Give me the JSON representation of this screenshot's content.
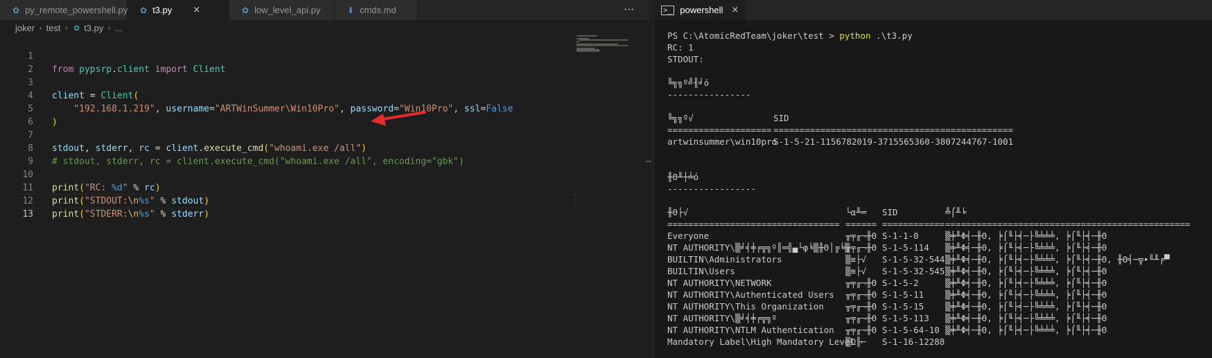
{
  "editor": {
    "tabs": [
      {
        "label": "py_remote_powershell.py",
        "icon": "python-file-icon",
        "active": false
      },
      {
        "label": "t3.py",
        "icon": "python-file-icon",
        "active": true
      },
      {
        "label": "low_level_api.py",
        "icon": "python-file-icon",
        "active": false
      },
      {
        "label": "cmds.md",
        "icon": "markdown-file-icon",
        "active": false
      }
    ],
    "more": "···",
    "close": "×",
    "breadcrumb": [
      "joker",
      "test",
      "t3.py",
      "..."
    ],
    "line_numbers": [
      "1",
      "2",
      "3",
      "4",
      "5",
      "6",
      "7",
      "8",
      "9",
      "10",
      "11",
      "12",
      "13"
    ],
    "code": {
      "l1": {
        "from": "from",
        "module": "pypsrp",
        "dot": ".",
        "mod2": "client",
        "import": "import",
        "cls": "Client"
      },
      "l3": {
        "var": "client",
        "eq": " = ",
        "cls": "Client",
        "paren": "("
      },
      "l4": {
        "ip": "\"192.168.1.219\"",
        "c1": ", ",
        "k1": "username",
        "e1": "=",
        "user": "\"ARTWinSummer\\Win10Pro\"",
        "c2": ", ",
        "k2": "password",
        "e2": "=",
        "pw": "\"Win10Pro\"",
        "c3": ", ",
        "k3": "ssl",
        "e3": "=",
        "ssl": "False"
      },
      "l5": ")",
      "l7": {
        "v1": "stdout",
        "c1": ", ",
        "v2": "stderr",
        "c2": ", ",
        "v3": "rc",
        "eq": " = ",
        "obj": "client",
        "dot": ".",
        "fn": "execute_cmd",
        "p1": "(",
        "arg": "\"whoami.exe /all\"",
        "p2": ")"
      },
      "l8": "# stdout, stderr, rc = client.execute_cmd(\"whoami.exe /all\", encoding=\"gbk\")",
      "l10": {
        "fn": "print",
        "p1": "(",
        "s1": "\"RC: ",
        "esc": "%d",
        "s2": "\"",
        "op": " % ",
        "v": "rc",
        "p2": ")"
      },
      "l11": {
        "fn": "print",
        "p1": "(",
        "s1": "\"STDOUT:",
        "esc1": "\\n",
        "esc2": "%s",
        "s2": "\"",
        "op": " % ",
        "v": "stdout",
        "p2": ")"
      },
      "l12": {
        "fn": "print",
        "p1": "(",
        "s1": "\"STDERR:",
        "esc1": "\\n",
        "esc2": "%s",
        "s2": "\"",
        "op": " % ",
        "v": "stderr",
        "p2": ")"
      }
    }
  },
  "terminal": {
    "tab_label": "powershell",
    "tab_icon": "terminal-icon",
    "prompt": "PS C:\\AtomicRedTeam\\joker\\test > ",
    "cmd": "python",
    "cmd_args": " .\\t3.py",
    "rc_line": "RC: 1",
    "stdout_line": "STDOUT:",
    "user_info_header": "╚╗╗º╝╢╛ó",
    "user_info_rule": "----------------",
    "user_table_h1": "╚╗╗º√",
    "user_table_h2": "SID",
    "user_table_rule1": "====================",
    "user_table_rule2": "==============================================",
    "user_row_name": "artwinsummer\\win10pro",
    "user_row_sid": "S-1-5-21-1156782019-3715565360-3807244767-1001",
    "groups_header": "╫Θ╨┼╧ó",
    "groups_rule": "-----------------",
    "groups_h1": "╫Θ├√",
    "groups_h2": "└α╨═",
    "groups_h3": "SID",
    "groups_h4": "╩⌠╨╘",
    "groups_r1": "=================================",
    "groups_r2": "======",
    "groups_r3": "============",
    "groups_r4": "===============================================",
    "groups": [
      {
        "name": "Everyone",
        "type": "╥╤╓¬╫Θ",
        "sid": "S-1-1-0",
        "attr": "▒╪╨Φ╡─╫Θ, ╞⌠╙├╡─├╚╧╧╧, ╞⌠╙├╡─╫Θ"
      },
      {
        "name": "NT AUTHORITY\\▒╛╡╪╒╦╗º║═╣▄└φ╘▒╫Θ│╔╘▒",
        "type": "╥╤╓¬╫Θ",
        "sid": "S-1-5-114",
        "attr": "▒╪╨Φ╡─╫Θ, ╞⌠╙├╡─├╚╧╧╧, ╞⌠╙├╡─╫Θ"
      },
      {
        "name": "BUILTIN\\Administrators",
        "type": "▒≡├√",
        "sid": "S-1-5-32-544",
        "attr": "▒╪╨Φ╡─╫Θ, ╞⌠╙├╡─├╚╧╧╧, ╞⌠╙├╡─╫Θ, ╫Θ╡─╦∙╙╨╒▀"
      },
      {
        "name": "BUILTIN\\Users",
        "type": "▒≡├√",
        "sid": "S-1-5-32-545",
        "attr": "▒╪╨Φ╡─╫Θ, ╞⌠╙├╡─├╚╧╧╧, ╞⌠╙├╡─╫Θ"
      },
      {
        "name": "NT AUTHORITY\\NETWORK",
        "type": "╥╤╓¬╫Θ",
        "sid": "S-1-5-2",
        "attr": "▒╪╨Φ╡─╫Θ, ╞⌠╙├╡─├╚╧╧╧, ╞⌠╙├╡─╫Θ"
      },
      {
        "name": "NT AUTHORITY\\Authenticated Users",
        "type": "╥╤╓¬╫Θ",
        "sid": "S-1-5-11",
        "attr": "▒╪╨Φ╡─╫Θ, ╞⌠╙├╡─├╚╧╧╧, ╞⌠╙├╡─╫Θ"
      },
      {
        "name": "NT AUTHORITY\\This Organization",
        "type": "╥╤╓¬╫Θ",
        "sid": "S-1-5-15",
        "attr": "▒╪╨Φ╡─╫Θ, ╞⌠╙├╡─├╚╧╧╧, ╞⌠╙├╡─╫Θ"
      },
      {
        "name": "NT AUTHORITY\\▒╛╡╪╒╦╗º",
        "type": "╥╤╓¬╫Θ",
        "sid": "S-1-5-113",
        "attr": "▒╪╨Φ╡─╫Θ, ╞⌠╙├╡─├╚╧╧╧, ╞⌠╙├╡─╫Θ"
      },
      {
        "name": "NT AUTHORITY\\NTLM Authentication",
        "type": "╥╤╓¬╫Θ",
        "sid": "S-1-5-64-10",
        "attr": "▒╪╨Φ╡─╫Θ, ╞⌠╙├╡─├╚╧╧╧, ╞⌠╙├╡─╫Θ"
      },
      {
        "name": "Mandatory Label\\High Mandatory Level",
        "type": "▒Ω╟⌐",
        "sid": "S-1-16-12288",
        "attr": ""
      }
    ]
  }
}
